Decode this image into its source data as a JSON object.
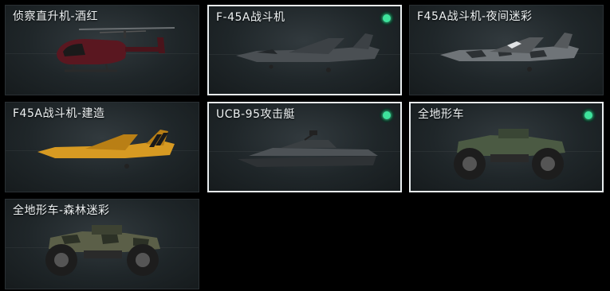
{
  "items": [
    {
      "label": "侦察直升机-酒红",
      "equipped": false,
      "selected": false,
      "vehicle_icon": "scout-helicopter-icon"
    },
    {
      "label": "F-45A战斗机",
      "equipped": true,
      "selected": true,
      "vehicle_icon": "fighter-jet-icon"
    },
    {
      "label": "F45A战斗机-夜间迷彩",
      "equipped": false,
      "selected": false,
      "vehicle_icon": "fighter-jet-camo-icon"
    },
    {
      "label": "F45A战斗机-建造",
      "equipped": false,
      "selected": false,
      "vehicle_icon": "fighter-jet-yellow-icon"
    },
    {
      "label": "UCB-95攻击艇",
      "equipped": true,
      "selected": true,
      "vehicle_icon": "attack-boat-icon"
    },
    {
      "label": "全地形车",
      "equipped": true,
      "selected": true,
      "vehicle_icon": "atv-icon"
    },
    {
      "label": "全地形车-森林迷彩",
      "equipped": false,
      "selected": false,
      "vehicle_icon": "atv-camo-icon"
    }
  ],
  "colors": {
    "equipped_indicator": "#3ee39c",
    "selected_border": "#e9eef0",
    "card_background": "#1f2629"
  }
}
